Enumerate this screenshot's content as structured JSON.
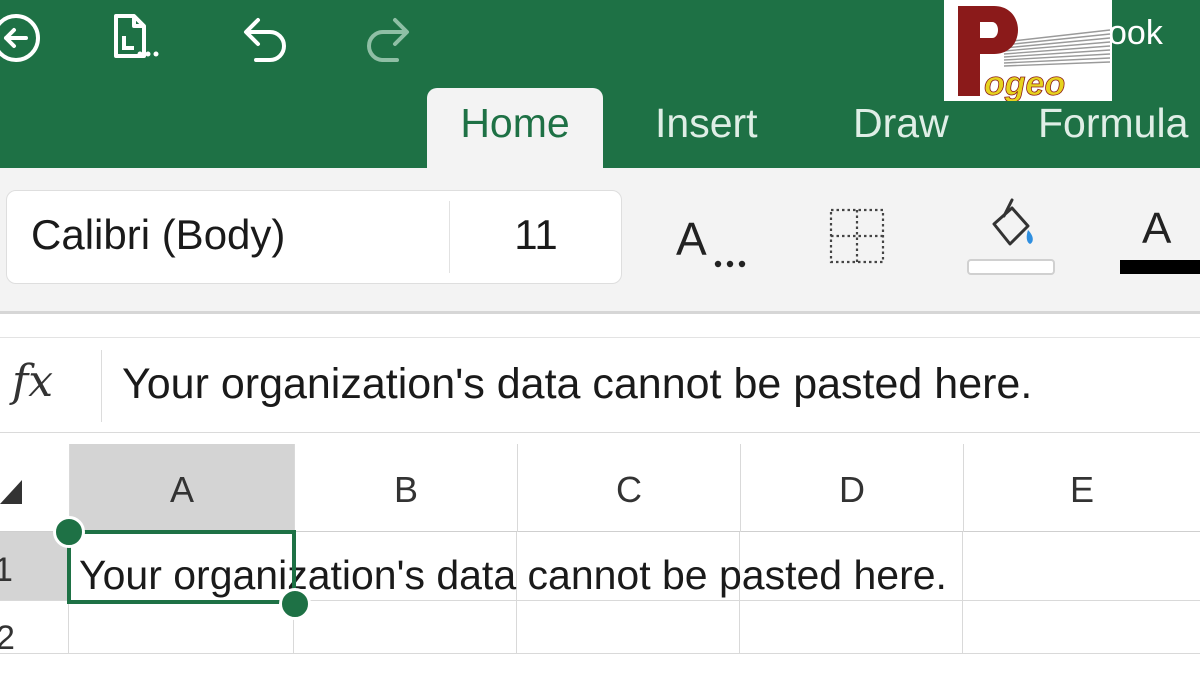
{
  "titlebar": {
    "doc_title_fragment": "ook",
    "back_icon": "back-circle-icon",
    "file_icon": "file-options-icon",
    "undo_icon": "undo-icon",
    "redo_icon": "redo-icon"
  },
  "tabs": [
    {
      "label": "Home",
      "selected": true
    },
    {
      "label": "Insert",
      "selected": false
    },
    {
      "label": "Draw",
      "selected": false
    },
    {
      "label": "Formula",
      "selected": false
    }
  ],
  "logo": {
    "text": "Pogeo"
  },
  "ribbon": {
    "font_name": "Calibri (Body)",
    "font_size": "11",
    "font_style_label": "A",
    "font_color_label": "A",
    "font_color": "#000000",
    "fill_color": "none"
  },
  "formula_bar": {
    "fx_label": "fx",
    "content": "Your organization's data cannot be pasted here."
  },
  "grid": {
    "columns": [
      "A",
      "B",
      "C",
      "D",
      "E"
    ],
    "rows": [
      "1",
      "2"
    ],
    "selected_cell": "A1",
    "cells": {
      "A1": "Your organization's data cannot be pasted here."
    }
  },
  "colors": {
    "accent": "#1e7145",
    "header_selected": "#d4d4d4",
    "ribbon_bg": "#f3f3f3"
  }
}
